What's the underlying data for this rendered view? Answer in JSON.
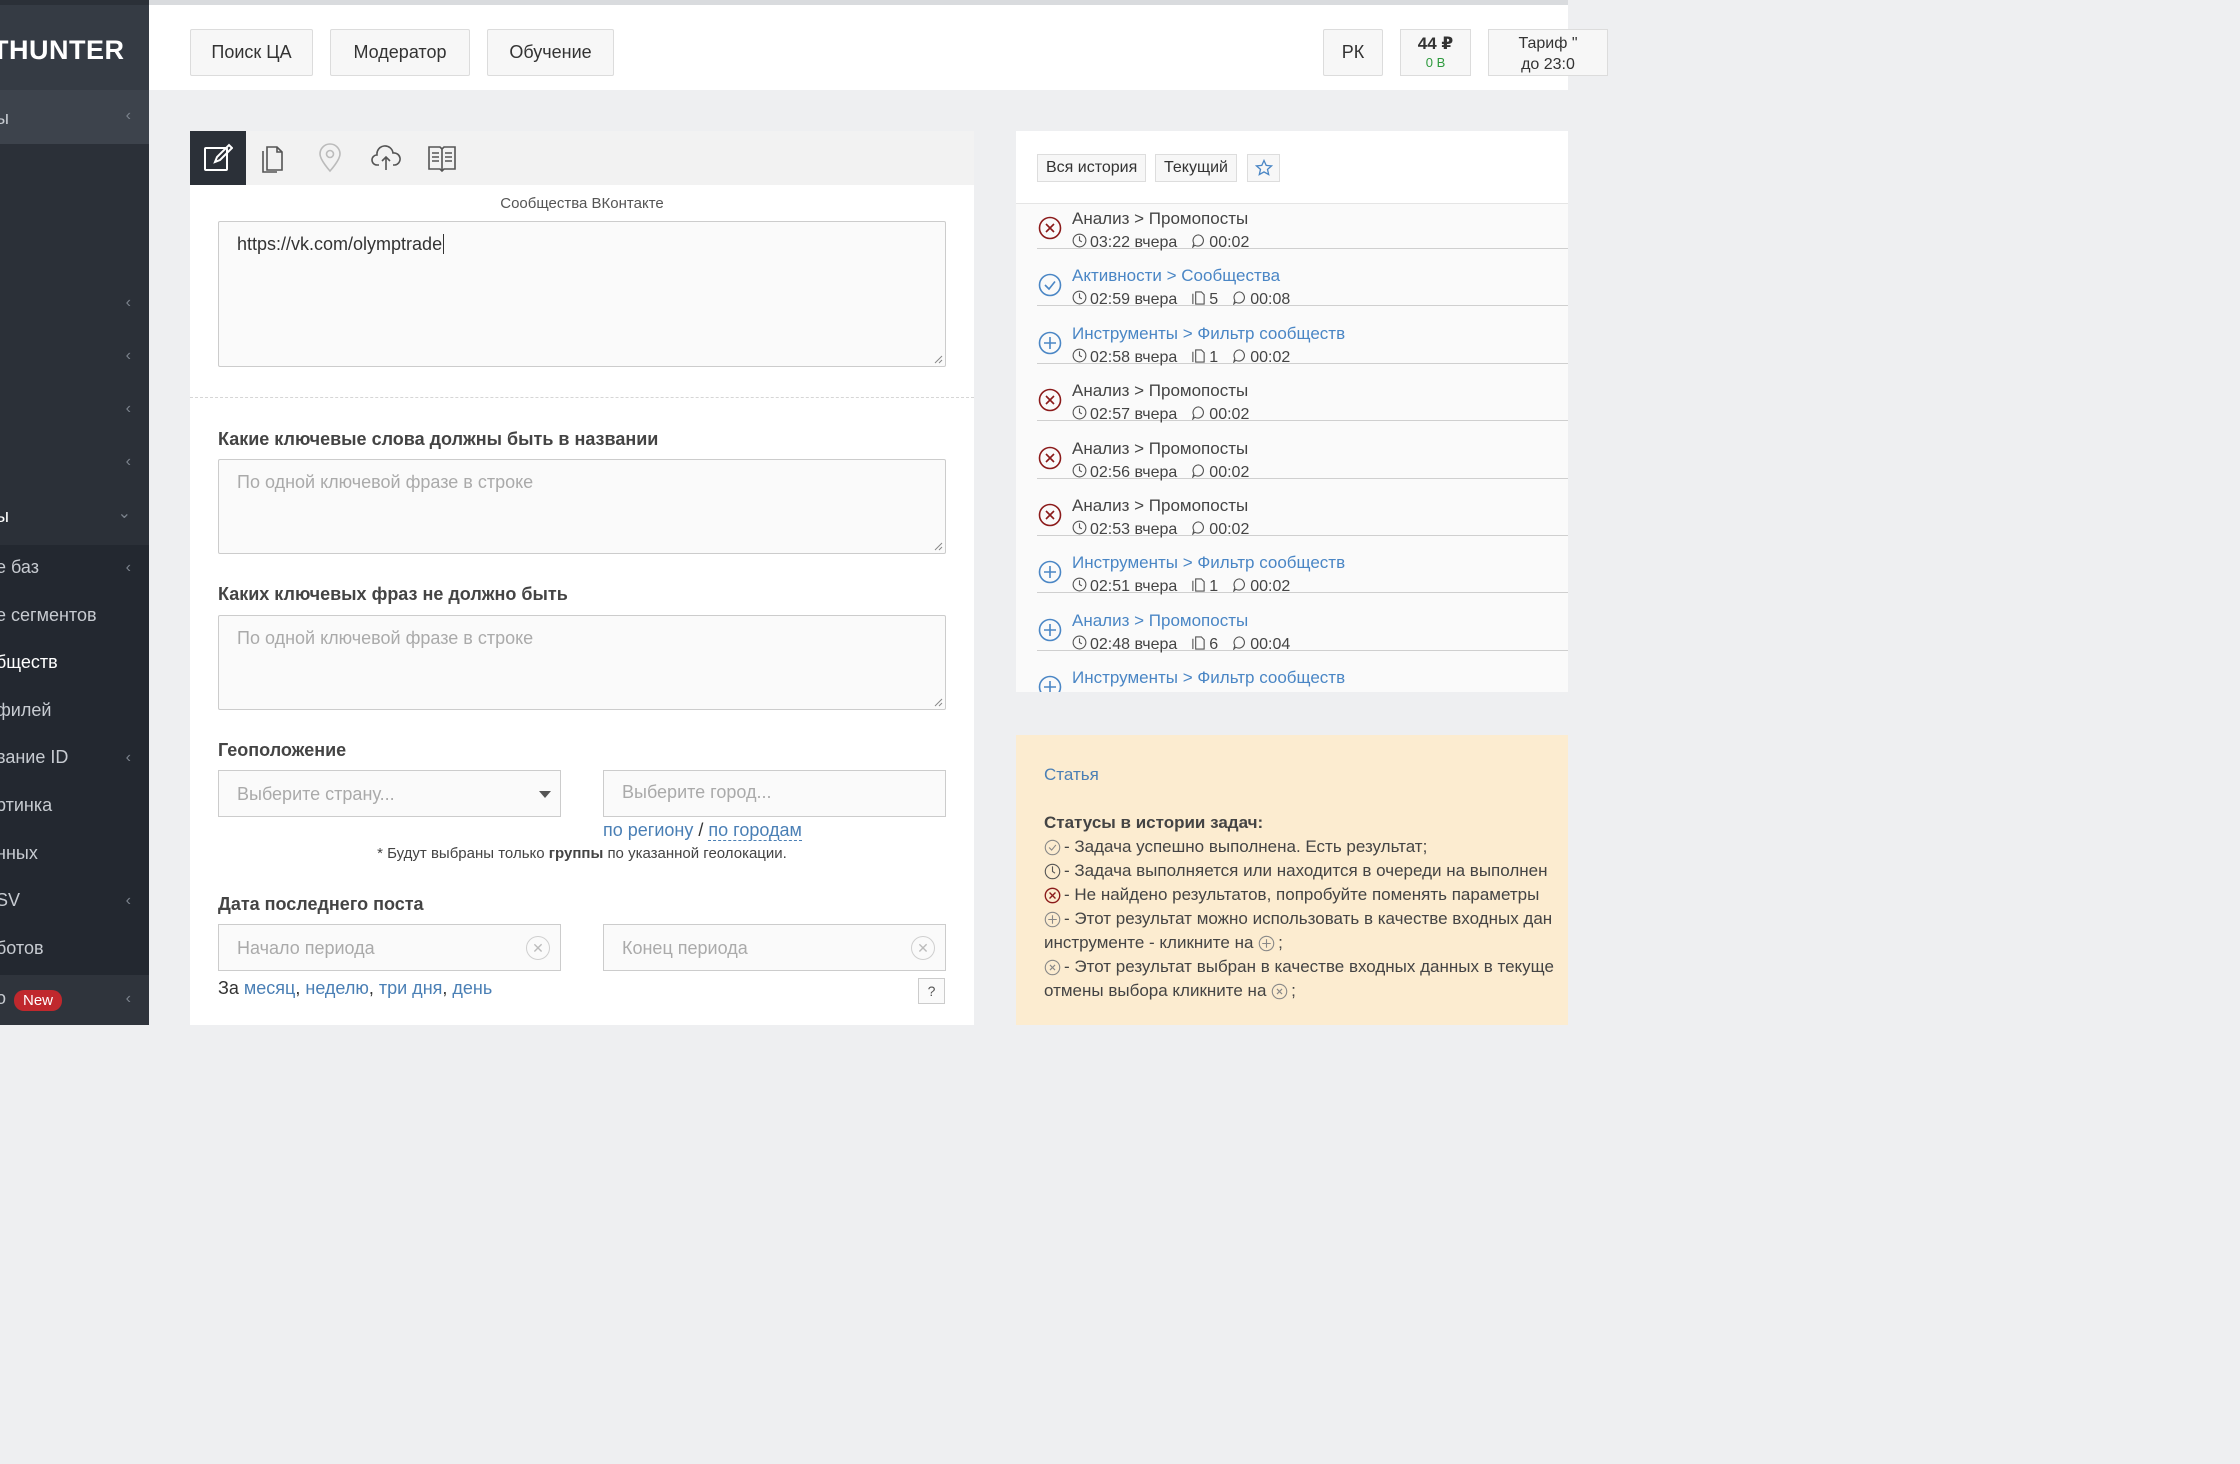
{
  "sidebar": {
    "logo": "THUNTER",
    "items": [
      {
        "label": "ы",
        "chevron": "‹"
      },
      {
        "label": "",
        "chevron": "‹"
      },
      {
        "label": "",
        "chevron": "‹"
      },
      {
        "label": "",
        "chevron": "‹"
      },
      {
        "label": "",
        "chevron": "‹"
      },
      {
        "label": "ы",
        "chevron": "⌄"
      },
      {
        "label": "е баз",
        "chevron": "‹"
      },
      {
        "label": "е сегментов",
        "chevron": ""
      },
      {
        "label": "бществ",
        "chevron": ""
      },
      {
        "label": "филей",
        "chevron": ""
      },
      {
        "label": "вание ID",
        "chevron": "‹"
      },
      {
        "label": "ртинка",
        "chevron": ""
      },
      {
        "label": "нных",
        "chevron": ""
      },
      {
        "label": "SV",
        "chevron": "‹"
      },
      {
        "label": "ботов",
        "chevron": ""
      },
      {
        "label": "о",
        "chevron": "‹"
      }
    ],
    "new_badge": "New"
  },
  "topbar": {
    "buttons": [
      "Поиск ЦА",
      "Модератор",
      "Обучение"
    ],
    "rk": "РК",
    "balance": "44 ₽",
    "balance_sub": "0 В",
    "tariff_line1": "Тариф \"",
    "tariff_line2": "до 23:0"
  },
  "form": {
    "tabs": [
      "edit-icon",
      "files-icon",
      "location-icon",
      "cloud-upload-icon",
      "book-icon"
    ],
    "source_caption": "Сообщества ВКонтакте",
    "source_value": "https://vk.com/olymptrade",
    "kw_in_label": "Какие ключевые слова должны быть в названии",
    "kw_in_placeholder": "По одной ключевой фразе в строке",
    "kw_out_label": "Каких ключевых фраз не должно быть",
    "kw_out_placeholder": "По одной ключевой фразе в строке",
    "geo_label": "Геоположение",
    "country_placeholder": "Выберите страну...",
    "city_placeholder": "Выберите город...",
    "by_region": "по региону",
    "geo_sep": "/",
    "by_city": "по городам",
    "geo_note_pre": "* Будут выбраны только",
    "geo_note_bold": "группы",
    "geo_note_post": "по указанной геолокации.",
    "date_label": "Дата последнего поста",
    "start_placeholder": "Начало периода",
    "end_placeholder": "Конец периода",
    "period_prefix": "За",
    "period_month": "месяц",
    "period_week": "неделю",
    "period_3days": "три дня",
    "period_day": "день",
    "help": "?"
  },
  "history": {
    "all_btn": "Вся история",
    "current_btn": "Текущий",
    "rows": [
      {
        "status": "error",
        "title": "Анализ > Промопосты",
        "time": "03:22 вчера",
        "count": "",
        "dur": "00:02",
        "link": false
      },
      {
        "status": "done",
        "title": "Активности > Сообщества",
        "time": "02:59 вчера",
        "count": "5",
        "dur": "00:08",
        "link": true
      },
      {
        "status": "add",
        "title": "Инструменты > Фильтр сообществ",
        "time": "02:58 вчера",
        "count": "1",
        "dur": "00:02",
        "link": true
      },
      {
        "status": "error",
        "title": "Анализ > Промопосты",
        "time": "02:57 вчера",
        "count": "",
        "dur": "00:02",
        "link": false
      },
      {
        "status": "error",
        "title": "Анализ > Промопосты",
        "time": "02:56 вчера",
        "count": "",
        "dur": "00:02",
        "link": false
      },
      {
        "status": "error",
        "title": "Анализ > Промопосты",
        "time": "02:53 вчера",
        "count": "",
        "dur": "00:02",
        "link": false
      },
      {
        "status": "add",
        "title": "Инструменты > Фильтр сообществ",
        "time": "02:51 вчера",
        "count": "1",
        "dur": "00:02",
        "link": true
      },
      {
        "status": "add",
        "title": "Анализ > Промопосты",
        "time": "02:48 вчера",
        "count": "6",
        "dur": "00:04",
        "link": true
      },
      {
        "status": "add",
        "title": "Инструменты > Фильтр сообществ",
        "time": "",
        "count": "",
        "dur": "",
        "link": true
      }
    ]
  },
  "info": {
    "article": "Статья",
    "heading": "Статусы в истории задач:",
    "line1": "- Задача успешно выполнена. Есть результат;",
    "line2": "- Задача выполняется или находится в очереди на выполнен",
    "line3": "- Не найдено результатов, попробуйте поменять параметры",
    "line4": "- Этот результат можно использовать в качестве входных дан",
    "line5_pre": "инструменте - кликните на",
    "line5_post": ";",
    "line6": "- Этот результат выбран в качестве входных данных в текуще",
    "line7_pre": "отмены выбора кликните на",
    "line7_post": ";"
  }
}
